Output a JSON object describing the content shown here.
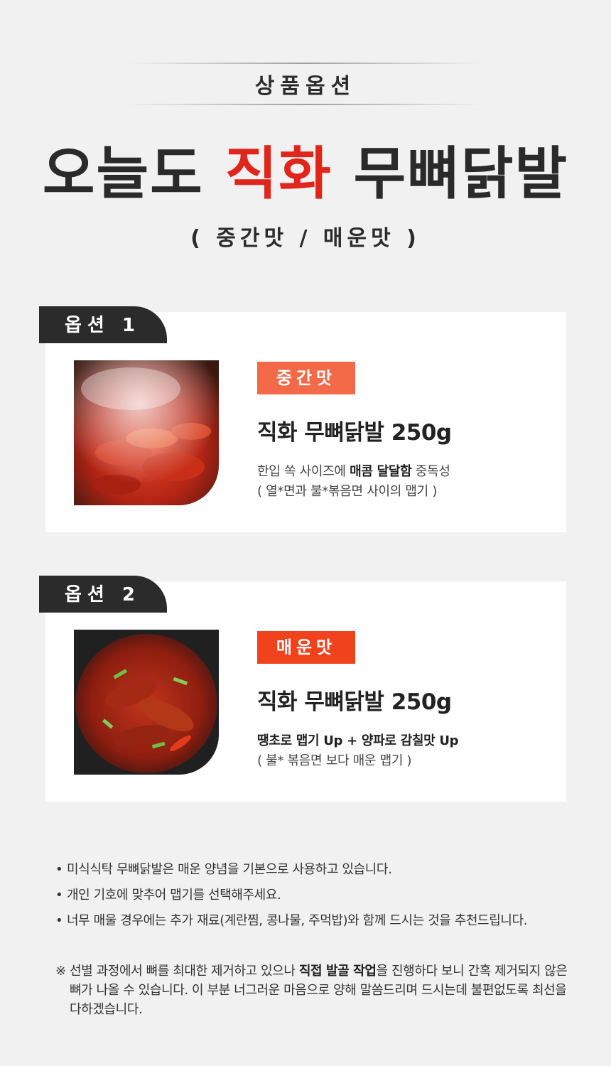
{
  "header": {
    "label": "상품옵션",
    "title_part1": "오늘도",
    "title_accent": "직화",
    "title_part2": "무뼈닭발",
    "subtitle": "( 중간맛 / 매운맛 )"
  },
  "options": [
    {
      "tab": "옵션 1",
      "badge": "중간맛",
      "badge_color": "#f26a47",
      "name": "직화 무뼈닭발 250g",
      "line1_pre": "한입 쏙 사이즈에 ",
      "line1_bold": "매콤 달달함",
      "line1_post": " 중독성",
      "line2": "( 열*면과 불*볶음면 사이의 맵기 )"
    },
    {
      "tab": "옵션 2",
      "badge": "매운맛",
      "badge_color": "#f0421c",
      "name": "직화 무뼈닭발 250g",
      "line1_pre": "",
      "line1_bold": "땡초로 맵기 Up + 양파로 감칠맛 Up",
      "line1_post": "",
      "line2": "( 불* 볶음면 보다 매운 맵기 )"
    }
  ],
  "notes": [
    "미식식탁 무뼈닭발은 매운 양념을 기본으로 사용하고 있습니다.",
    "개인 기호에 맞추어 맵기를 선택해주세요.",
    "너무 매울 경우에는 추가 재료(계란찜, 콩나물, 주먹밥)와 함께 드시는 것을 추천드립니다."
  ],
  "remark": {
    "pre": "※ 선별 과정에서 뼈를 최대한 제거하고 있으나 ",
    "bold": "직접 발골 작업",
    "post": "을 진행하다 보니 간혹 제거되지 않은 뼈가 나올 수 있습니다. 이 부분 너그러운 마음으로 양해 말씀드리며 드시는데 불편없도록 최선을 다하겠습니다."
  }
}
